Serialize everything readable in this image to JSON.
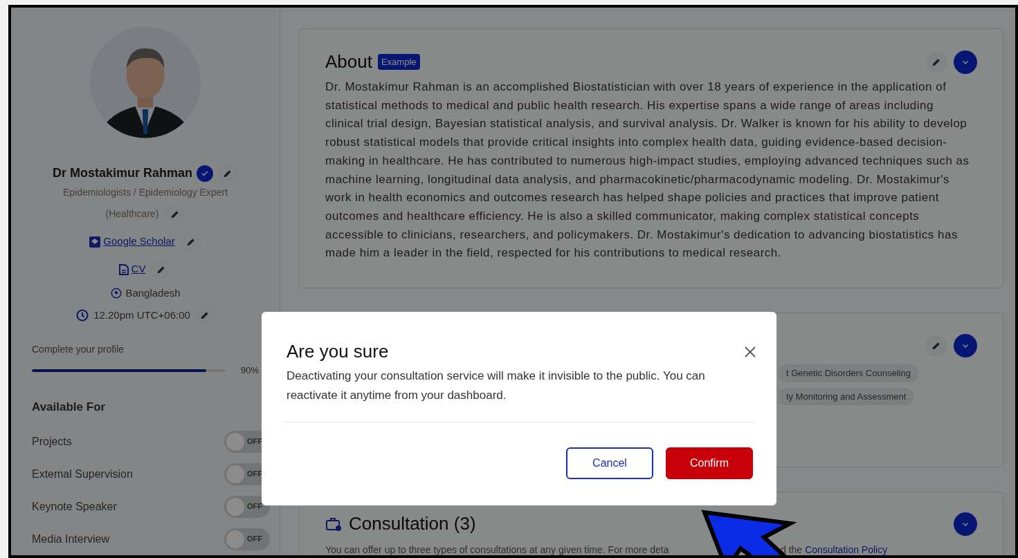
{
  "profile": {
    "name": "Dr Mostakimur Rahman",
    "verified": true,
    "title": "Epidemiologists / Epidemiology Expert",
    "field": "(Healthcare)",
    "links": [
      {
        "kind": "scholar",
        "label": "Google Scholar"
      },
      {
        "kind": "cv",
        "label": "CV"
      }
    ],
    "location": "Bangladesh",
    "time": "12.20pm UTC+06:00"
  },
  "completion": {
    "label": "Complete your profile",
    "level": 0.9,
    "reading": "90%"
  },
  "available_for": {
    "title": "Available For",
    "items": [
      {
        "label": "Projects",
        "on": false,
        "state_label": "OFF"
      },
      {
        "label": "Extemal Supervision",
        "on": false,
        "state_label": "OFF"
      },
      {
        "label": "Keynote Speaker",
        "on": false,
        "state_label": "OFF"
      },
      {
        "label": "Media Interview",
        "on": false,
        "state_label": "OFF"
      }
    ]
  },
  "about": {
    "title": "About",
    "badge": "Example",
    "text": "Dr. Mostakimur Rahman is an accomplished Biostatistician with over 18 years of experience in the application of statistical methods to medical and public health research. His expertise spans a wide range of areas including clinical trial design, Bayesian statistical analysis, and survival analysis. Dr. Walker is known for his ability to develop robust statistical models that provide critical insights into complex health data, guiding evidence-based decision-making in healthcare. He has contributed to numerous high-impact studies, employing advanced techniques such as machine learning, longitudinal data analysis, and pharmacokinetic/pharmacodynamic modeling. Dr. Mostakimur's work in health economics and outcomes research has helped shape policies and practices that improve patient outcomes and healthcare efficiency. He is also a skilled communicator, making complex statistical concepts accessible to clinicians, researchers, and policymakers. Dr. Mostakimur's dedication to advancing biostatistics has made him a leader in the field, respected for his contributions to medical research."
  },
  "skills": {
    "tags": [
      "t Genetic Disorders Counseling",
      "ty Monitoring and Assessment"
    ]
  },
  "consultation": {
    "title": "Consultation (3)",
    "note_start": "You can offer up to three types of consultations at any given time. For more deta",
    "note_end": "d the",
    "policy_link": "Consultation Policy"
  },
  "dialog": {
    "title": "Are you sure",
    "message": "Deactivating your consultation service will make it invisible to the public. You can reactivate it anytime from your dashboard.",
    "buttons": [
      {
        "kind": "secondary",
        "label": "Cancel"
      },
      {
        "kind": "primary",
        "label": "Confirm"
      }
    ]
  }
}
